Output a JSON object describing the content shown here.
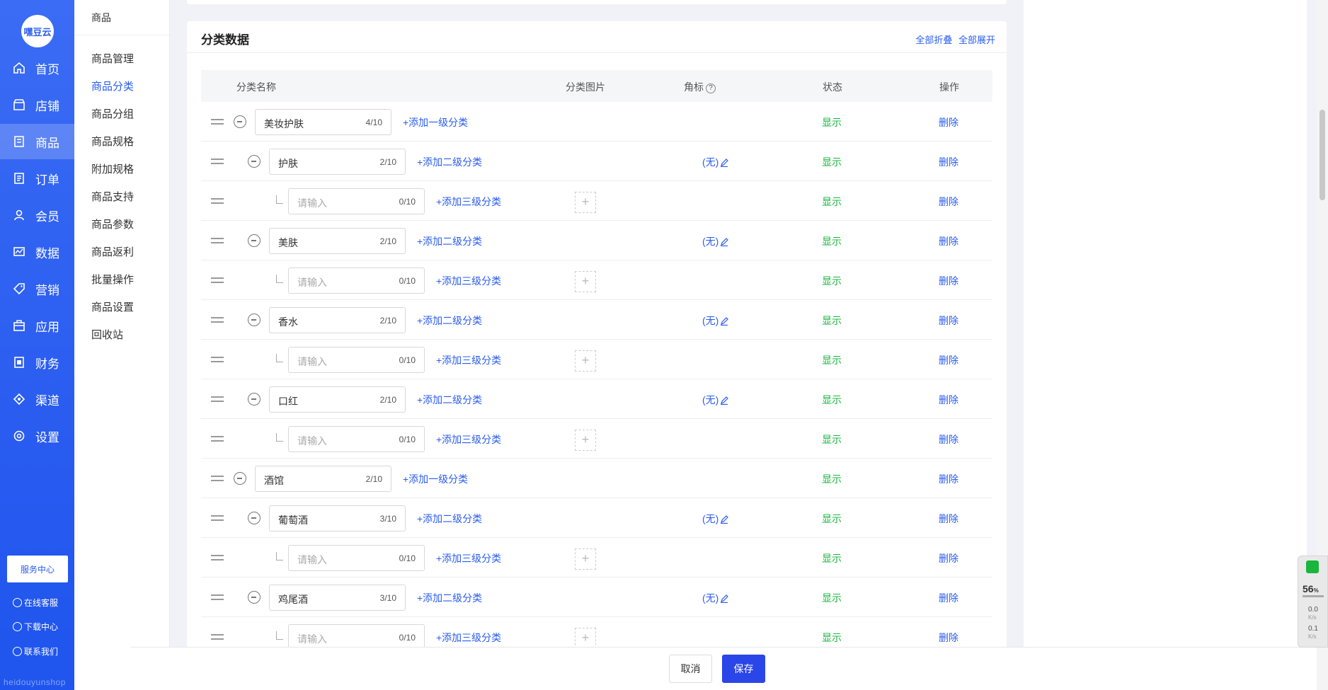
{
  "logo": {
    "text": "嘿豆云"
  },
  "leftnav": [
    {
      "label": "首页",
      "icon": "home-icon"
    },
    {
      "label": "店铺",
      "icon": "store-icon"
    },
    {
      "label": "商品",
      "icon": "goods-icon",
      "active": true
    },
    {
      "label": "订单",
      "icon": "order-icon"
    },
    {
      "label": "会员",
      "icon": "member-icon"
    },
    {
      "label": "数据",
      "icon": "data-icon"
    },
    {
      "label": "营销",
      "icon": "tag-icon"
    },
    {
      "label": "应用",
      "icon": "app-icon"
    },
    {
      "label": "财务",
      "icon": "finance-icon"
    },
    {
      "label": "渠道",
      "icon": "channel-icon"
    },
    {
      "label": "设置",
      "icon": "gear-icon"
    }
  ],
  "service": {
    "label": "服务中心"
  },
  "bottom_links": [
    "在线客服",
    "下载中心",
    "联系我们"
  ],
  "brand_footer": "heidouyunshop",
  "subnav": {
    "title": "商品",
    "items": [
      "商品管理",
      "商品分类",
      "商品分组",
      "商品规格",
      "附加规格",
      "商品支持",
      "商品参数",
      "商品返利",
      "批量操作",
      "商品设置",
      "回收站"
    ],
    "active": "商品分类"
  },
  "card": {
    "title": "分类数据",
    "collapse_all": "全部折叠",
    "expand_all": "全部展开"
  },
  "table": {
    "headers": {
      "name": "分类名称",
      "image": "分类图片",
      "badge": "角标",
      "status": "状态",
      "op": "操作"
    },
    "help_glyph": "?",
    "rows": [
      {
        "level": 1,
        "value": "美妆护肤",
        "count": "4/10",
        "add": "+添加一级分类",
        "status": "显示",
        "op": "删除"
      },
      {
        "level": 2,
        "value": "护肤",
        "count": "2/10",
        "add": "+添加二级分类",
        "badge": "(无)",
        "status": "显示",
        "op": "删除"
      },
      {
        "level": 3,
        "value": "请输入",
        "placeholder": true,
        "count": "0/10",
        "add": "+添加三级分类",
        "status": "显示",
        "op": "删除"
      },
      {
        "level": 2,
        "value": "美肤",
        "count": "2/10",
        "add": "+添加二级分类",
        "badge": "(无)",
        "status": "显示",
        "op": "删除"
      },
      {
        "level": 3,
        "value": "请输入",
        "placeholder": true,
        "count": "0/10",
        "add": "+添加三级分类",
        "status": "显示",
        "op": "删除"
      },
      {
        "level": 2,
        "value": "香水",
        "count": "2/10",
        "add": "+添加二级分类",
        "badge": "(无)",
        "status": "显示",
        "op": "删除"
      },
      {
        "level": 3,
        "value": "请输入",
        "placeholder": true,
        "count": "0/10",
        "add": "+添加三级分类",
        "status": "显示",
        "op": "删除"
      },
      {
        "level": 2,
        "value": "口红",
        "count": "2/10",
        "add": "+添加二级分类",
        "badge": "(无)",
        "status": "显示",
        "op": "删除"
      },
      {
        "level": 3,
        "value": "请输入",
        "placeholder": true,
        "count": "0/10",
        "add": "+添加三级分类",
        "status": "显示",
        "op": "删除"
      },
      {
        "level": 1,
        "value": "酒馆",
        "count": "2/10",
        "add": "+添加一级分类",
        "status": "显示",
        "op": "删除"
      },
      {
        "level": 2,
        "value": "葡萄酒",
        "count": "3/10",
        "add": "+添加二级分类",
        "badge": "(无)",
        "status": "显示",
        "op": "删除"
      },
      {
        "level": 3,
        "value": "请输入",
        "placeholder": true,
        "count": "0/10",
        "add": "+添加三级分类",
        "status": "显示",
        "op": "删除"
      },
      {
        "level": 2,
        "value": "鸡尾酒",
        "count": "3/10",
        "add": "+添加二级分类",
        "badge": "(无)",
        "status": "显示",
        "op": "删除"
      },
      {
        "level": 3,
        "value": "请输入",
        "placeholder": true,
        "count": "0/10",
        "add": "+添加三级分类",
        "status": "显示",
        "op": "删除"
      }
    ]
  },
  "footer": {
    "cancel": "取消",
    "save": "保存"
  },
  "widget": {
    "percent": "56",
    "percent_unit": "%",
    "up": "0.0",
    "down": "0.1",
    "unit": "K/s"
  },
  "colors": {
    "primary": "#2a5cf0",
    "status_green": "#19b53c",
    "save_button": "#2a45e8"
  }
}
